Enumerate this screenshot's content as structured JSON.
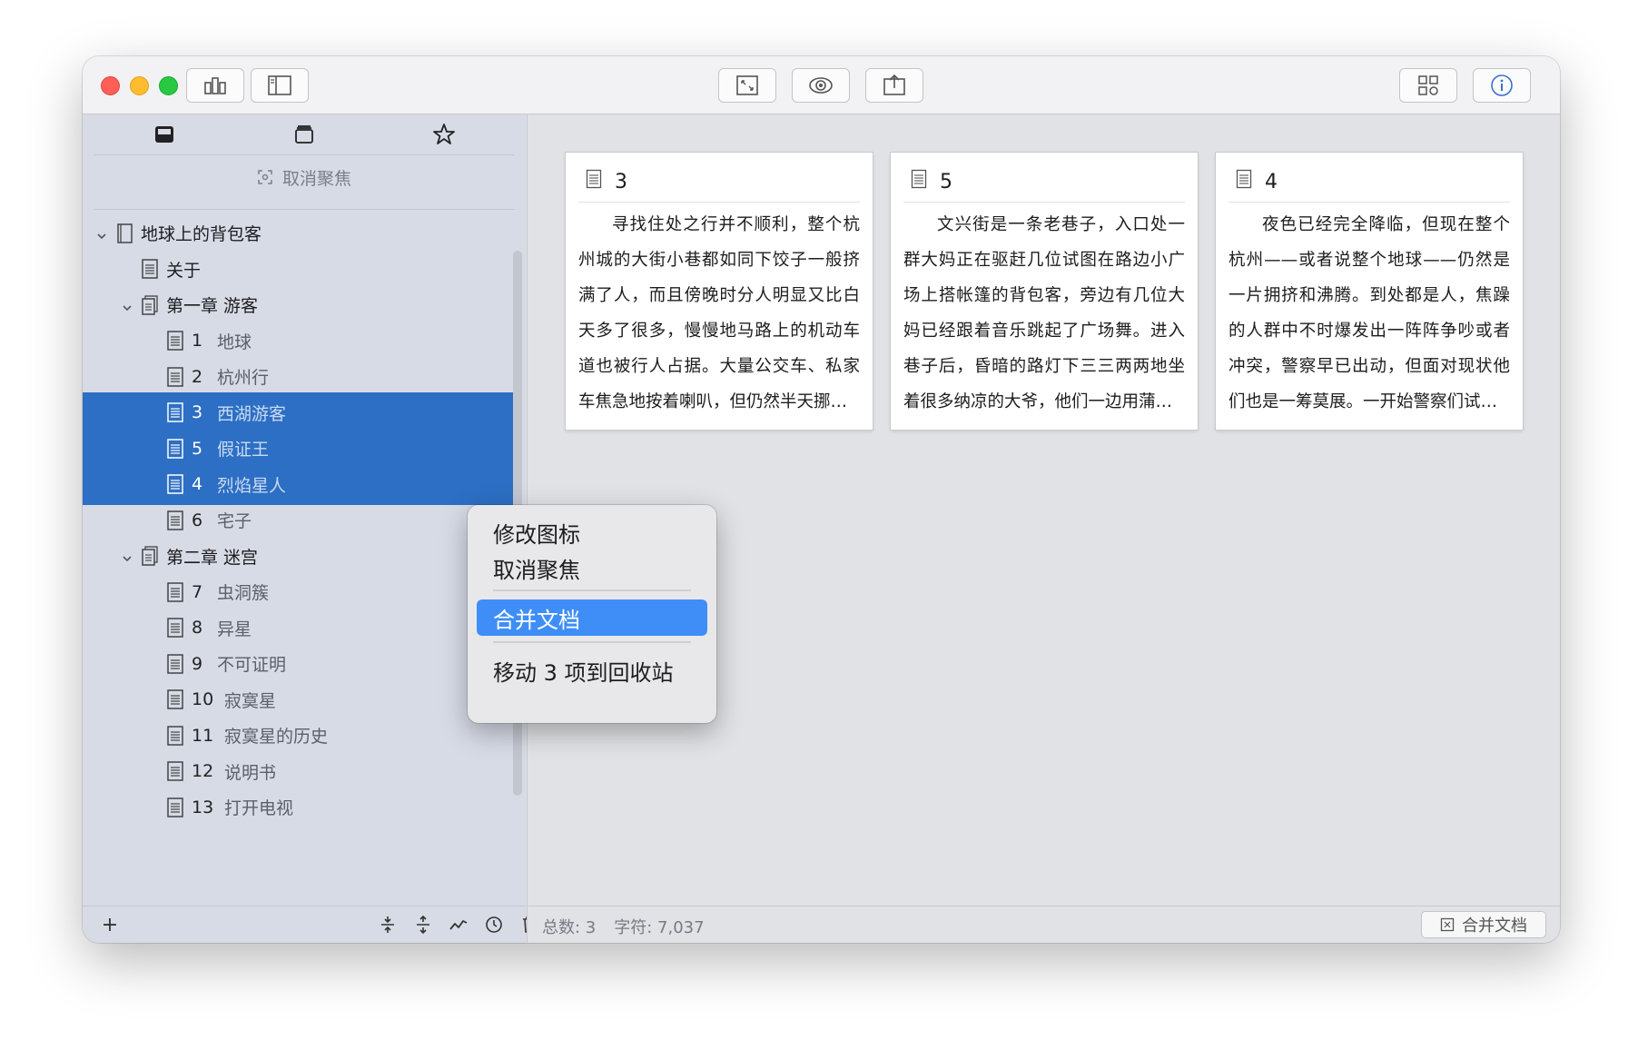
{
  "toolbar": {
    "left_buttons": [
      "group-icon",
      "sidebar-toggle-icon"
    ],
    "center_buttons": [
      "fullscreen-icon",
      "preview-eye-icon",
      "share-icon"
    ],
    "right_buttons": [
      "grid-shapes-icon",
      "info-icon"
    ]
  },
  "sidebar": {
    "tabs": [
      "inbox-tray-icon",
      "archive-box-icon",
      "star-icon"
    ],
    "unfocus_label": "取消聚焦",
    "tree": [
      {
        "level": 0,
        "expanded": true,
        "label": "地球上的背包客",
        "type": "folder"
      },
      {
        "level": 1,
        "label": "关于",
        "type": "doc"
      },
      {
        "level": 1,
        "expanded": true,
        "label": "第一章 游客",
        "type": "folder"
      },
      {
        "level": 2,
        "num": "1",
        "name": "地球",
        "type": "doc"
      },
      {
        "level": 2,
        "num": "2",
        "name": "杭州行",
        "type": "doc"
      },
      {
        "level": 2,
        "num": "3",
        "name": "西湖游客",
        "type": "doc",
        "selected": true
      },
      {
        "level": 2,
        "num": "5",
        "name": "假证王",
        "type": "doc",
        "selected": true
      },
      {
        "level": 2,
        "num": "4",
        "name": "烈焰星人",
        "type": "doc",
        "selected": true
      },
      {
        "level": 2,
        "num": "6",
        "name": "宅子",
        "type": "doc"
      },
      {
        "level": 1,
        "expanded": true,
        "label": "第二章 迷宫",
        "type": "folder"
      },
      {
        "level": 2,
        "num": "7",
        "name": "虫洞簇",
        "type": "doc"
      },
      {
        "level": 2,
        "num": "8",
        "name": "异星",
        "type": "doc"
      },
      {
        "level": 2,
        "num": "9",
        "name": "不可证明",
        "type": "doc"
      },
      {
        "level": 2,
        "num": "10",
        "name": "寂寞星",
        "type": "doc"
      },
      {
        "level": 2,
        "num": "11",
        "name": "寂寞星的历史",
        "type": "doc"
      },
      {
        "level": 2,
        "num": "12",
        "name": "说明书",
        "type": "doc"
      },
      {
        "level": 2,
        "num": "13",
        "name": "打开电视",
        "type": "doc"
      }
    ],
    "footer": {
      "add_label": "+",
      "tools": [
        "expand-all-icon",
        "collapse-all-icon",
        "stats-chart-icon",
        "history-clock-icon",
        "trash-icon"
      ]
    }
  },
  "cards": [
    {
      "title": "3",
      "text": "寻找住处之行并不顺利，整个杭州城的大街小巷都如同下饺子一般挤满了人，而且傍晚时分人明显又比白天多了很多，慢慢地马路上的机动车道也被行人占据。大量公交车、私家车焦急地按着喇叭，但仍然半天挪…"
    },
    {
      "title": "5",
      "text": "文兴街是一条老巷子，入口处一群大妈正在驱赶几位试图在路边小广场上搭帐篷的背包客，旁边有几位大妈已经跟着音乐跳起了广场舞。进入巷子后，昏暗的路灯下三三两两地坐着很多纳凉的大爷，他们一边用蒲…"
    },
    {
      "title": "4",
      "text": "夜色已经完全降临，但现在整个杭州——或者说整个地球——仍然是一片拥挤和沸腾。到处都是人，焦躁的人群中不时爆发出一阵阵争吵或者冲突，警察早已出动，但面对现状他们也是一筹莫展。一开始警察们试…"
    }
  ],
  "status": {
    "count_label": "总数: 3",
    "chars_label": "字符: 7,037",
    "merge_button": "合并文档"
  },
  "context_menu": {
    "items": [
      "修改图标",
      "取消聚焦",
      "合并文档",
      "移动 3 项到回收站"
    ],
    "highlighted": "合并文档"
  },
  "colors": {
    "selection": "#2d6fc4",
    "menu_highlight": "#3f8ef7",
    "sidebar_bg": "#d7dbe6"
  }
}
